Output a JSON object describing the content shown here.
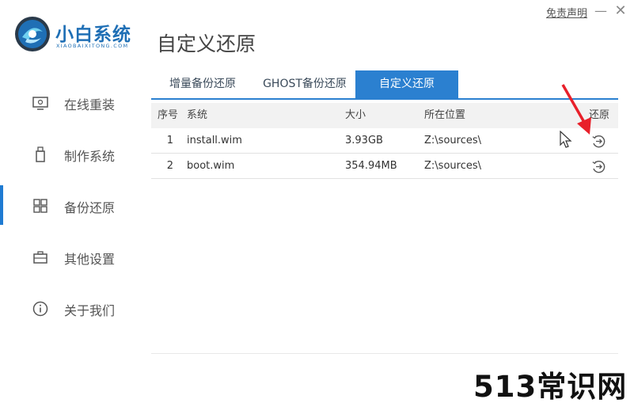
{
  "app": {
    "name": "小白系统",
    "subtitle": "XIAOBAIXITONG.COM",
    "page_title": "自定义还原",
    "disclaimer": "免责声明",
    "min_label": "—",
    "close_label": "✕"
  },
  "sidebar": {
    "items": [
      {
        "label": "在线重装",
        "icon": "monitor-icon"
      },
      {
        "label": "制作系统",
        "icon": "usb-drive-icon"
      },
      {
        "label": "备份还原",
        "icon": "grid-icon",
        "active": true
      },
      {
        "label": "其他设置",
        "icon": "briefcase-icon"
      },
      {
        "label": "关于我们",
        "icon": "info-icon"
      }
    ]
  },
  "tabs": [
    {
      "label": "增量备份还原"
    },
    {
      "label": "GHOST备份还原"
    },
    {
      "label": "自定义还原",
      "active": true
    }
  ],
  "table": {
    "headers": {
      "idx": "序号",
      "system": "系统",
      "size": "大小",
      "location": "所在位置",
      "restore": "还原"
    },
    "rows": [
      {
        "idx": "1",
        "system": "install.wim",
        "size": "3.93GB",
        "location": "Z:\\sources\\"
      },
      {
        "idx": "2",
        "system": "boot.wim",
        "size": "354.94MB",
        "location": "Z:\\sources\\"
      }
    ]
  },
  "watermark": "513常识网",
  "colors": {
    "accent": "#2b80d0",
    "logo": "#1f6fb5",
    "arrow": "#e8202a"
  }
}
